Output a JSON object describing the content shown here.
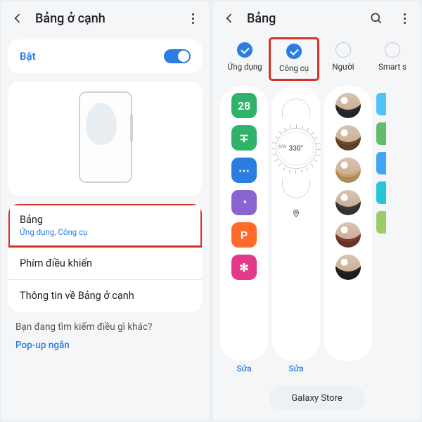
{
  "left": {
    "header_title": "Bảng ở cạnh",
    "toggle_label": "Bật",
    "panel_row": {
      "title": "Bảng",
      "subtitle": "Ứng dụng, Công cụ"
    },
    "row2": "Phím điều khiển",
    "row3": "Thông tin về Bảng ở cạnh",
    "prompt": "Bạn đang tìm kiếm điều gì khác?",
    "link": "Pop-up ngắn"
  },
  "right": {
    "header_title": "Bảng",
    "tabs": [
      {
        "label": "Ứng dụng",
        "checked": true
      },
      {
        "label": "Công cụ",
        "checked": true,
        "highlight": true
      },
      {
        "label": "Người",
        "checked": false
      },
      {
        "label": "Smart s",
        "checked": false
      }
    ],
    "apps": [
      {
        "name": "calendar",
        "char": "28",
        "bg": "#2fb26a"
      },
      {
        "name": "calculator",
        "char": "∓",
        "bg": "#2fb26a"
      },
      {
        "name": "messages",
        "char": "⋯",
        "bg": "#2a7de1"
      },
      {
        "name": "bixby",
        "char": "◔",
        "bg": "#8a63d2"
      },
      {
        "name": "notes",
        "char": "P",
        "bg": "#ff6a2b"
      },
      {
        "name": "apps",
        "char": "✻",
        "bg": "#e23a8a"
      }
    ],
    "compass_deg": "330°",
    "compass_dir": "NW",
    "edit": "Sửa",
    "store_button": "Galaxy Store",
    "side_colors": [
      "#4fc3f7",
      "#66bb6a",
      "#42a5f5",
      "#26c6da",
      "#9ccc65"
    ]
  }
}
